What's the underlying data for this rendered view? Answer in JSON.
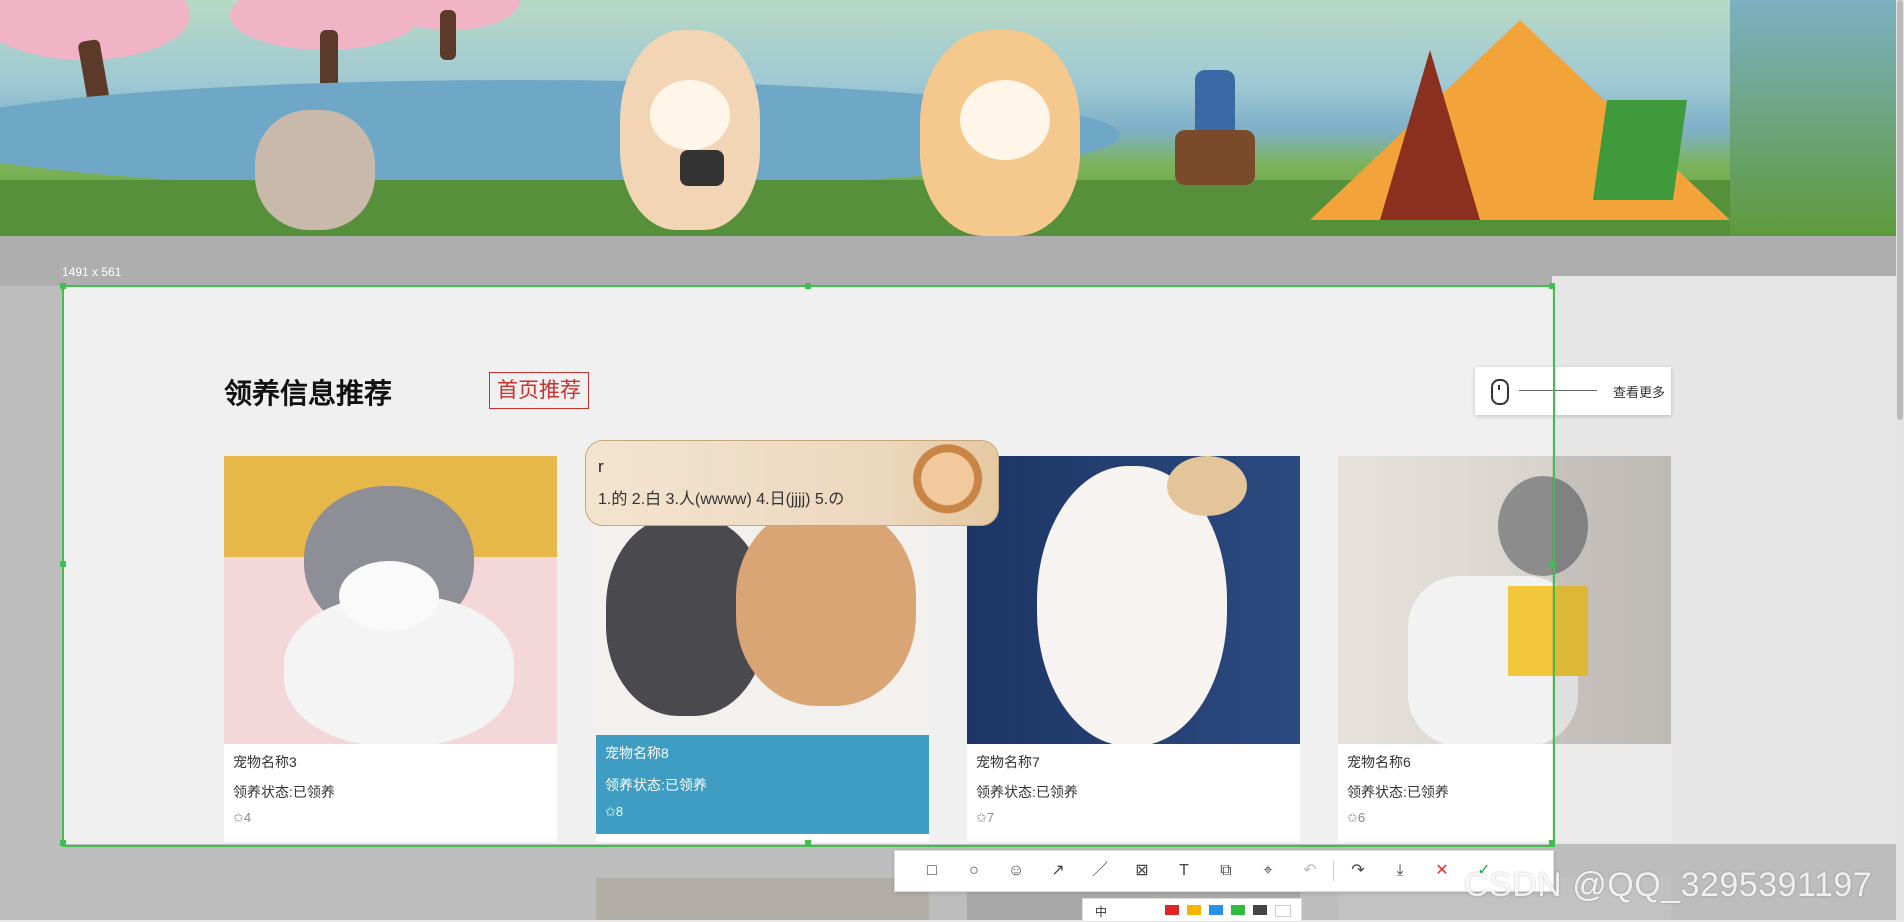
{
  "screenshot": {
    "size_label": "1491 x 561"
  },
  "section": {
    "title": "领养信息推荐",
    "recommend_button": "首页推荐",
    "more_label": "查看更多"
  },
  "cards": [
    {
      "name": "宠物名称3",
      "status": "领养状态:已领养",
      "stars": "✩4",
      "active": false
    },
    {
      "name": "宠物名称8",
      "status": "领养状态:已领养",
      "stars": "✩8",
      "active": true
    },
    {
      "name": "宠物名称7",
      "status": "领养状态:已领养",
      "stars": "✩7",
      "active": false
    },
    {
      "name": "宠物名称6",
      "status": "领养状态:已领养",
      "stars": "✩6",
      "active": false
    }
  ],
  "ime": {
    "input": "r",
    "candidates": "1.的  2.白  3.人(wwww)  4.日(jjjj)  5.の"
  },
  "toolbar": {
    "icons": [
      "rectangle-icon",
      "ellipse-icon",
      "emoji-icon",
      "arrow-icon",
      "line-icon",
      "mosaic-icon",
      "text-icon",
      "copy-icon",
      "capture-icon",
      "undo-icon",
      "share-icon",
      "download-icon",
      "close-icon",
      "confirm-icon"
    ],
    "size_label": "中"
  },
  "colors": {
    "selection": "#3fbf4f",
    "accent_red": "#c9302c",
    "card_active": "#3f9cc2"
  },
  "watermark": "CSDN @QQ_3295391197"
}
